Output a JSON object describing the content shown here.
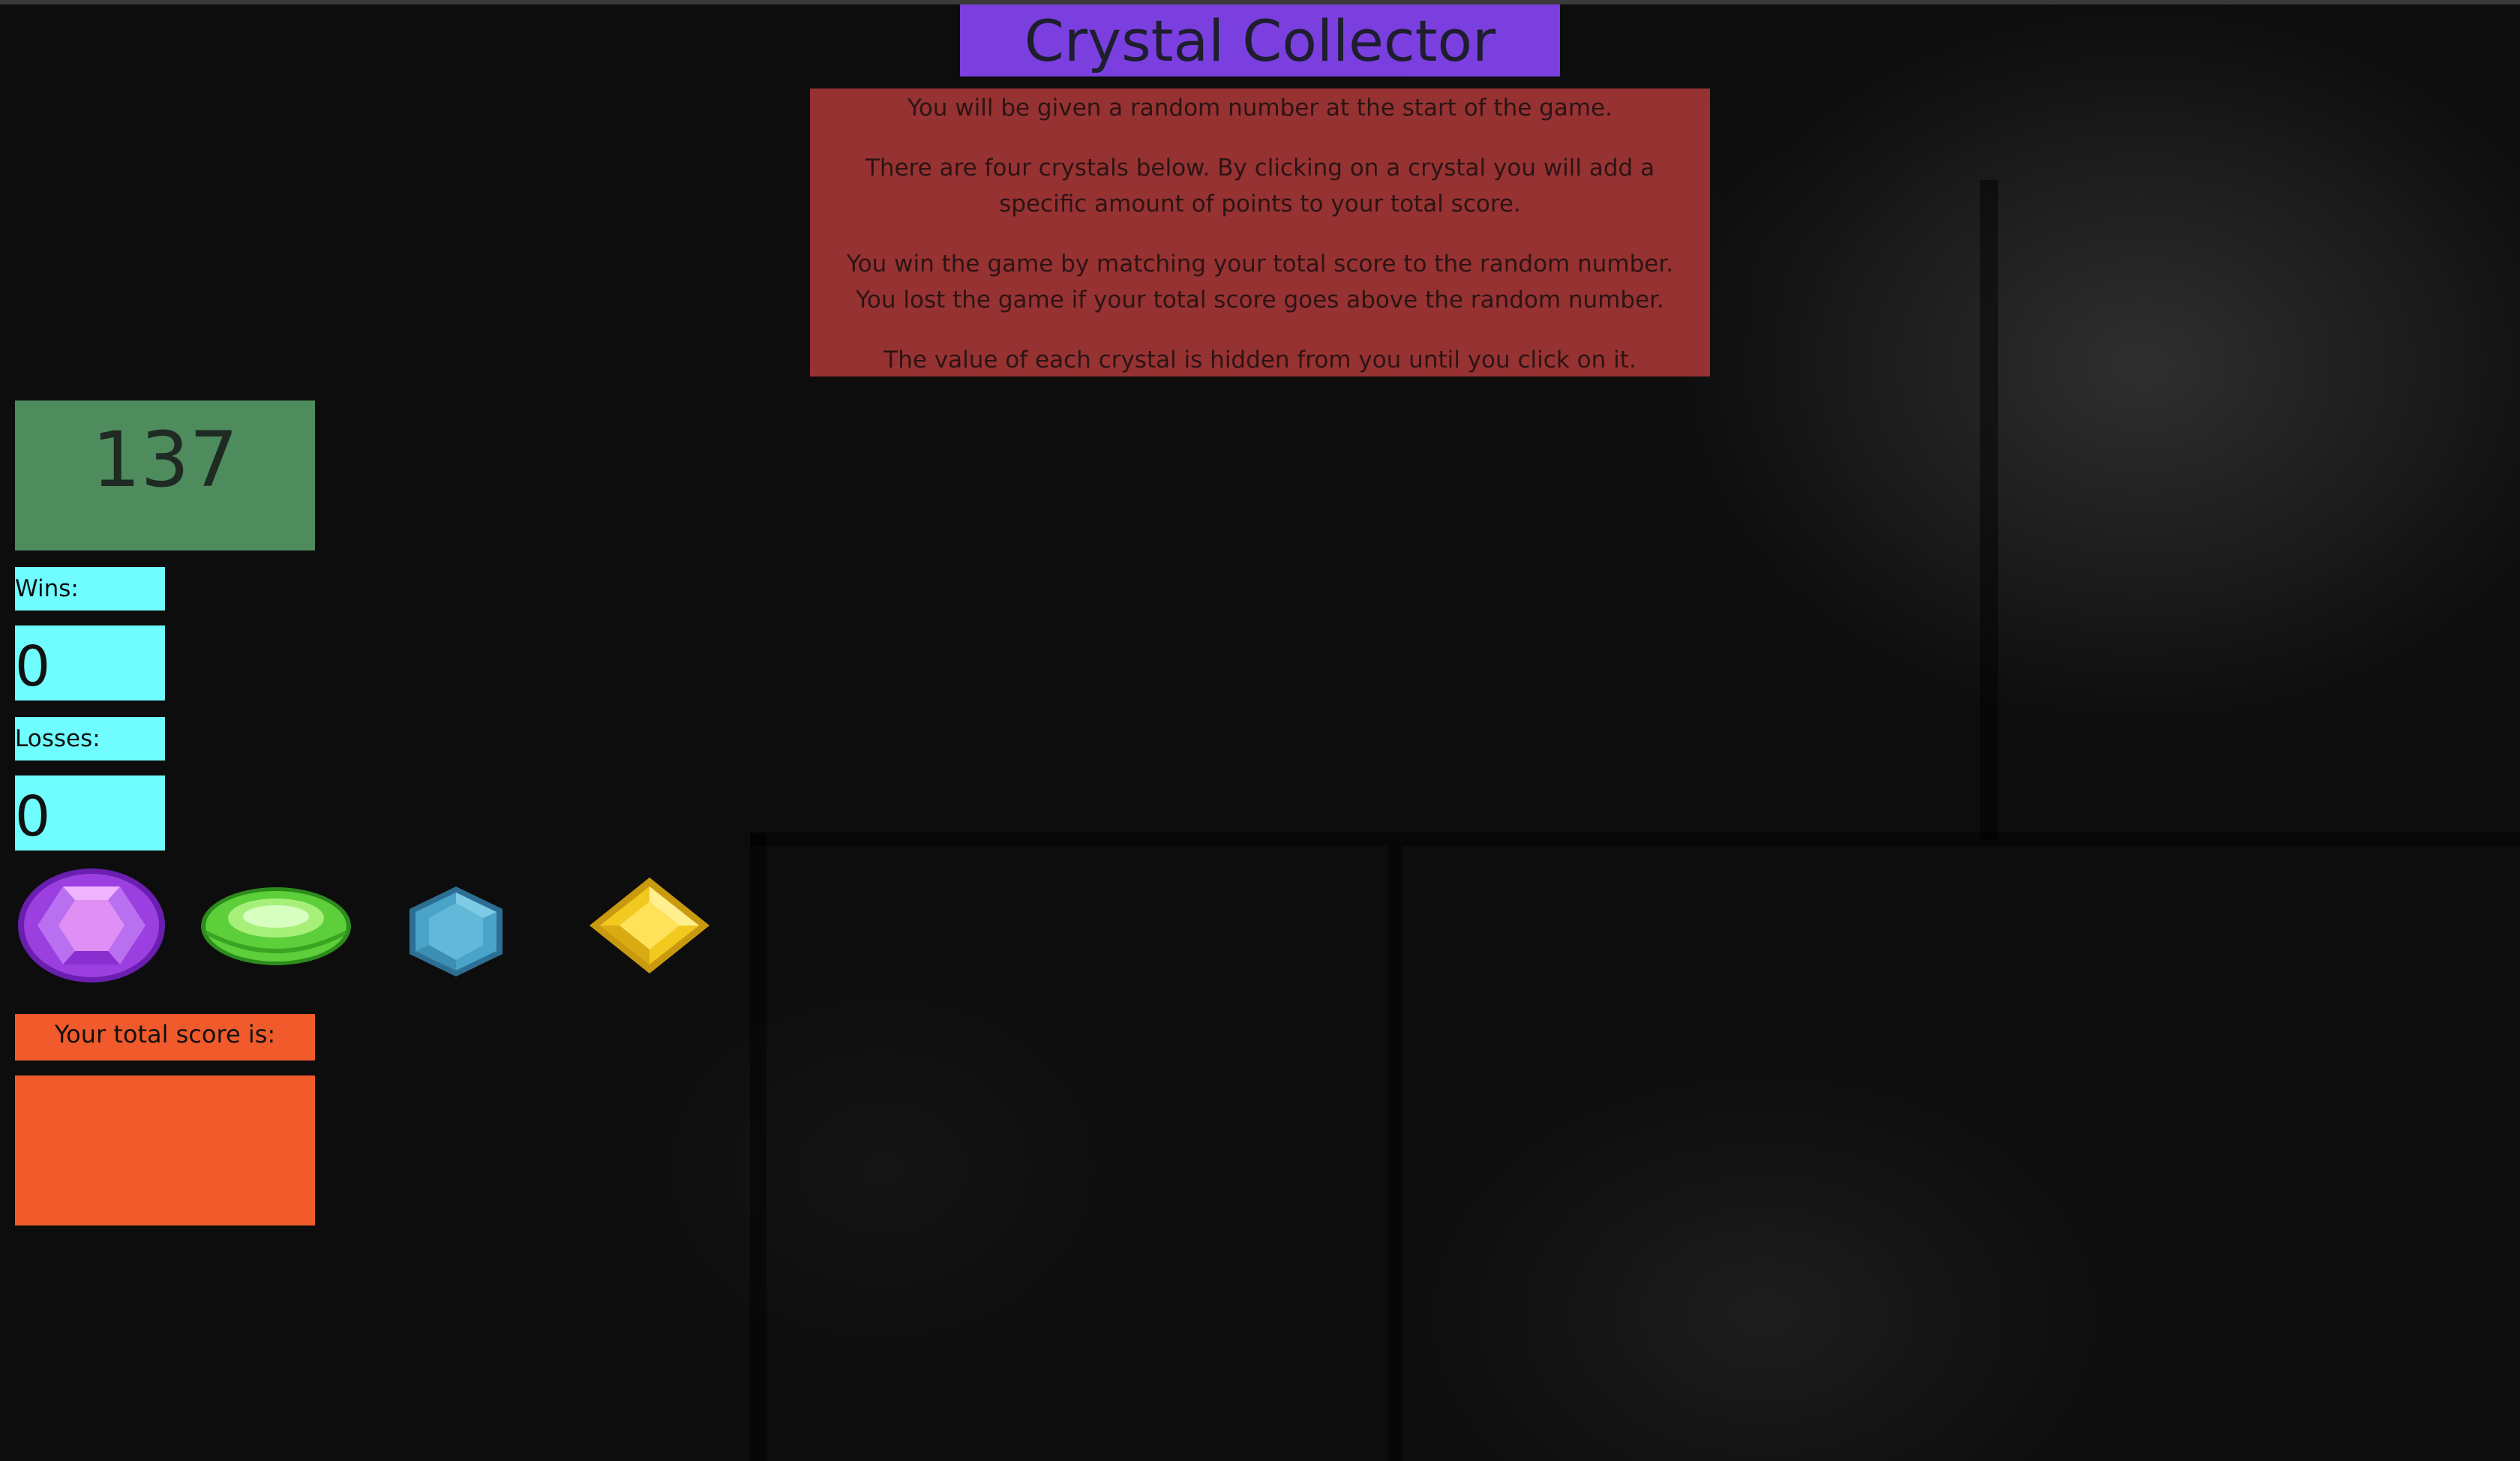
{
  "title": "Crystal Collector",
  "instructions": [
    "You will be given a random number at the start of the game.",
    "There are four crystals below. By clicking on a crystal you will add a specific amount of points to your total score.",
    "You win the game by matching your total score to the random number. You lost the game if your total score goes above the random number.",
    "The value of each crystal is hidden from you until you click on it."
  ],
  "random_number": "137",
  "wins": {
    "label": "Wins:",
    "value": "0"
  },
  "losses": {
    "label": "Losses:",
    "value": "0"
  },
  "crystals": [
    {
      "icon": "purple-crystal-icon",
      "color": "#9b3fe0"
    },
    {
      "icon": "green-crystal-icon",
      "color": "#3fbf2a"
    },
    {
      "icon": "blue-crystal-icon",
      "color": "#4aa3c8"
    },
    {
      "icon": "yellow-crystal-icon",
      "color": "#f2c91e"
    }
  ],
  "total_score": {
    "label": "Your total score is:",
    "value": ""
  },
  "colors": {
    "title_bg": "#7b3fe0",
    "info_bg": "#973232",
    "target_bg": "#4e8c5e",
    "stat_bg": "#6ffdff",
    "score_bg": "#f15a2b"
  }
}
